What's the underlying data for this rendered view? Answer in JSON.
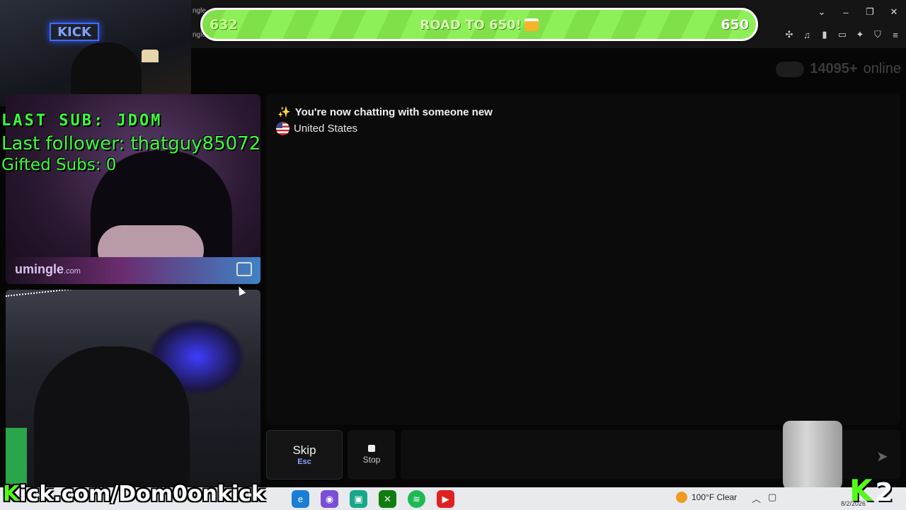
{
  "browser": {
    "tab_hint": "ngle",
    "window_controls": [
      "⌄",
      "–",
      "❐",
      "✕"
    ],
    "toolbar_icons": [
      "puzzle-icon",
      "music-icon",
      "sidebar-icon",
      "wallet-icon",
      "sparkle-icon",
      "shield-icon",
      "menu-icon"
    ]
  },
  "goal_bar": {
    "start": "632",
    "label": "ROAD TO 650!",
    "end": "650"
  },
  "online": {
    "count": "14095",
    "plus": "+",
    "label": "online"
  },
  "webcam": {
    "sign": "KICK"
  },
  "overlay": {
    "last_sub": "LAST SUB: JDOM",
    "last_follower": "Last follower: thatguy85072",
    "gifted_subs": "Gifted Subs: 0"
  },
  "stranger_video": {
    "brand": "umingle",
    "brand_suffix": ".com"
  },
  "chat": {
    "system_message": "You're now chatting with someone new",
    "country": "United States",
    "message_placeholder": ""
  },
  "controls": {
    "skip_label": "Skip",
    "skip_key": "Esc",
    "stop_label": "Stop"
  },
  "stream": {
    "kick_url_prefix": "K",
    "kick_url_rest": "ick.com/Dom0onkick",
    "corner_logo": "K",
    "corner_number": "2"
  },
  "taskbar": {
    "weather": "100°F  Clear",
    "apps": [
      "edge-icon",
      "chrome-icon",
      "terminal-icon",
      "xbox-icon",
      "spotify-icon",
      "youtube-icon"
    ],
    "date": "8/2/2026"
  },
  "colors": {
    "accent_green": "#53fc18",
    "overlay_green": "#3cff3c",
    "goal_green": "#7fe04a",
    "skip_key_blue": "#8ea4ff"
  }
}
